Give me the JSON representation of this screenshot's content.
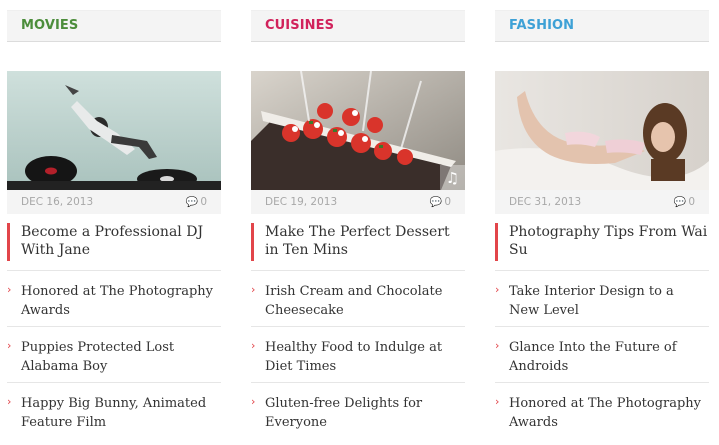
{
  "columns": [
    {
      "category": "MOVIES",
      "category_color": "#4c8d3b",
      "date": "DEC 16, 2013",
      "comments": "0",
      "headline": "Become a Professional DJ With Jane",
      "links": [
        "Honored at The Photography Awards",
        "Puppies Protected Lost Alabama Boy",
        "Happy Big Bunny, Animated Feature Film"
      ]
    },
    {
      "category": "CUISINES",
      "category_color": "#d1225b",
      "date": "DEC 19, 2013",
      "comments": "0",
      "headline": "Make The Perfect Dessert in Ten Mins",
      "links": [
        "Irish Cream and Chocolate Cheesecake",
        "Healthy Food to Indulge at Diet Times",
        "Gluten-free Delights for Everyone"
      ]
    },
    {
      "category": "FASHION",
      "category_color": "#3ea1d6",
      "date": "DEC 31, 2013",
      "comments": "0",
      "headline": "Photography Tips From Wai Su",
      "links": [
        "Take Interior Design to a New Level",
        "Glance Into the Future of Androids",
        "Honored at The Photography Awards"
      ]
    }
  ],
  "icons": {
    "list_bullet": "›",
    "comment": "comment-icon",
    "audio": "music-note-icon"
  },
  "accent_color": "#e2454a"
}
